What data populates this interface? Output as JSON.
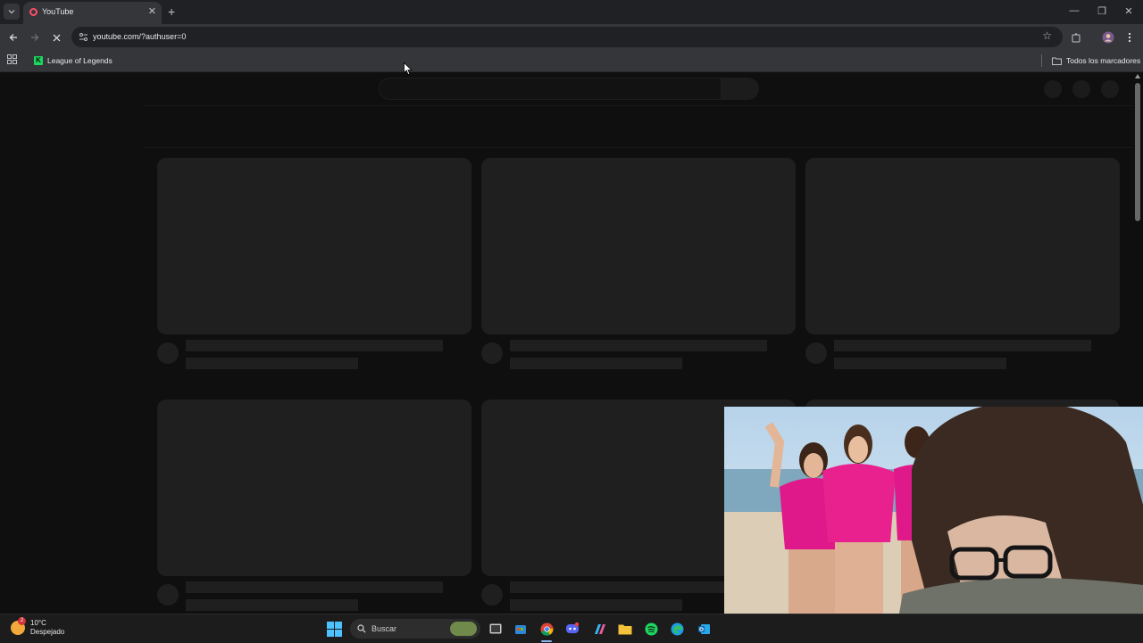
{
  "browser": {
    "tab": {
      "title": "YouTube"
    },
    "address_bar": {
      "url": "youtube.com/?authuser=0"
    },
    "bookmarks": {
      "items": [
        {
          "label": "League of Legends",
          "icon": "league-of-legends-icon"
        }
      ],
      "all_bookmarks_label": "Todos los marcadores"
    },
    "colors": {
      "chrome_bg": "#202124",
      "toolbar_bg": "#35363a",
      "page_bg": "#0f0f0f",
      "skeleton": "#1f1f1f",
      "favicon": "#ff4e6a"
    }
  },
  "page": {
    "state": "loading",
    "skeleton_cards": 6
  },
  "taskbar": {
    "weather": {
      "temperature": "10°C",
      "condition": "Despejado",
      "badge": "2"
    },
    "search_placeholder": "Buscar",
    "apps": [
      "widgets-icon",
      "task-view-icon",
      "store-icon",
      "chrome-icon",
      "discord-icon",
      "copilot-icon",
      "file-explorer-icon",
      "spotify-icon",
      "edge-icon",
      "outlook-icon"
    ]
  }
}
